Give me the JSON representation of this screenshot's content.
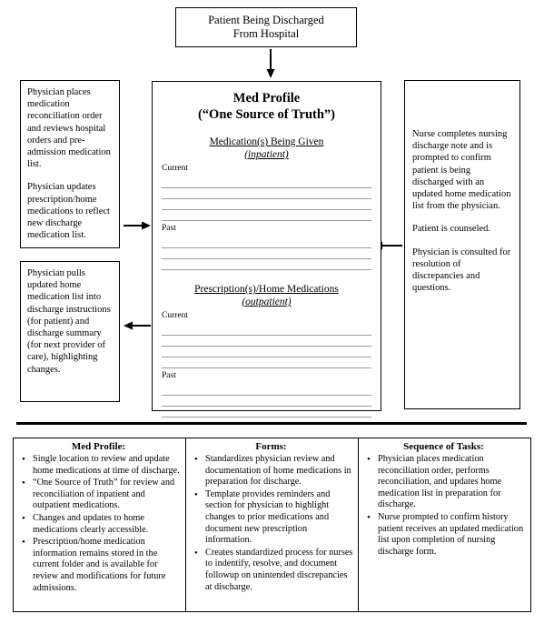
{
  "diagram": {
    "top_box": {
      "line1": "Patient Being Discharged",
      "line2": "From Hospital"
    },
    "center": {
      "title_line1": "Med Profile",
      "title_line2": "(“One Source of Truth”)",
      "section1": {
        "heading": "Medication(s) Being Given",
        "subheading": "(inpatient)",
        "current_label": "Current",
        "current_lines": 4,
        "past_label": "Past",
        "past_lines": 3
      },
      "section2": {
        "heading": "Prescription(s)/Home Medications",
        "subheading": "(outpatient)",
        "current_label": "Current",
        "current_lines": 4,
        "past_label": "Past",
        "past_lines": 3
      }
    },
    "left_top_box": {
      "paragraphs": [
        "Physician places medication reconciliation order and reviews hospital orders and pre-admission medication list.",
        "Physician updates prescription/home medications to reflect new discharge medication list."
      ]
    },
    "left_bottom_box": {
      "paragraphs": [
        "Physician pulls updated home medication list into discharge instructions (for patient) and discharge summary (for next provider of care), highlighting changes."
      ]
    },
    "right_box": {
      "paragraphs": [
        "Nurse completes nursing discharge note and is prompted to confirm patient is being discharged with an updated home medication list from the physician.",
        "Patient is counseled.",
        "Physician is consulted for resolution of discrepancies and questions."
      ]
    },
    "arrows": {
      "top_down": "arrow-down",
      "left_to_center": "arrow-right",
      "center_to_left": "arrow-left",
      "right_to_center": "arrow-left"
    }
  },
  "summary_table": {
    "columns": [
      {
        "heading": "Med Profile:",
        "bullets": [
          "Single location to review and update home medications at time of discharge.",
          "“One Source of Truth” for review and reconciliation of inpatient and outpatient medications.",
          "Changes and updates to home medications clearly accessible.",
          "Prescription/home medication information remains stored in the current folder and is available for review and modifications for future admissions."
        ]
      },
      {
        "heading": "Forms:",
        "bullets": [
          "Standardizes physician review and documentation of home medications in preparation for discharge.",
          "Template provides reminders and section for physician to highlight changes to prior medications and document new prescription information.",
          "Creates standardized process for nurses to indentify, resolve, and document followup on unintended discrepancies at discharge."
        ]
      },
      {
        "heading": "Sequence of Tasks:",
        "bullets": [
          "Physician places medication reconciliation order, performs reconciliation, and updates home medication list in preparation for discharge.",
          "Nurse prompted to confirm history patient receives an updated medication list upon completion of nursing discharge form."
        ]
      }
    ]
  }
}
